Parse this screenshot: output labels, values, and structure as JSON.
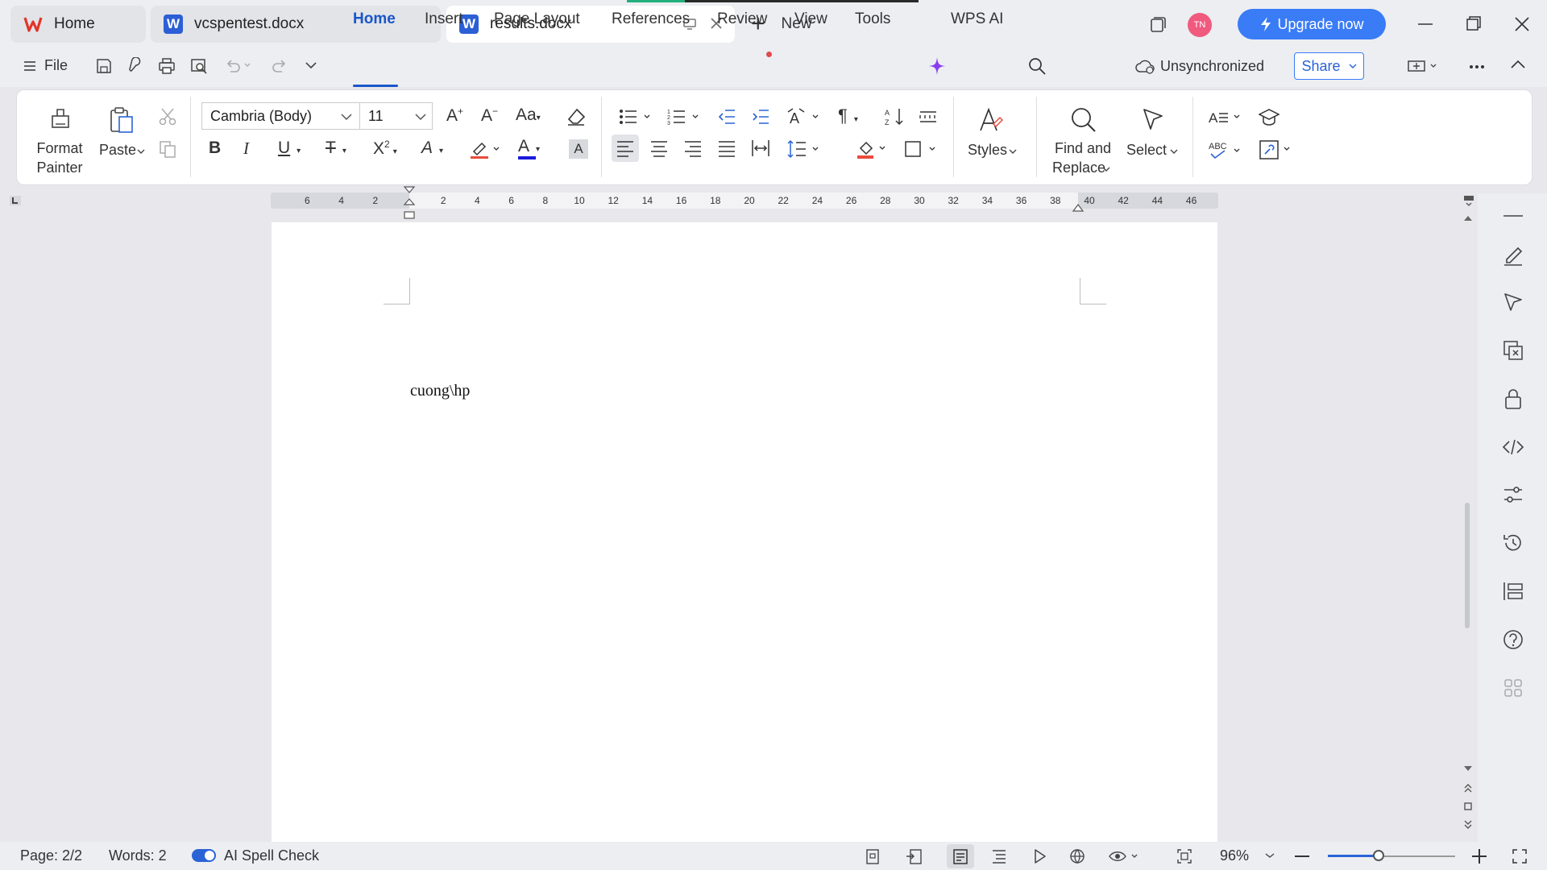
{
  "tabs": [
    {
      "label": "Home",
      "icon": "wps-logo-icon"
    },
    {
      "label": "vcspentest.docx",
      "icon": "word-doc-icon"
    },
    {
      "label": "results.docx",
      "icon": "word-doc-icon",
      "active": true
    }
  ],
  "new_tab_label": "New",
  "avatar_initials": "TN",
  "upgrade_label": "Upgrade now",
  "menu": {
    "file": "File",
    "items": [
      "Home",
      "Insert",
      "Page Layout",
      "References",
      "Review",
      "View",
      "Tools",
      "WPS AI"
    ],
    "sync_status": "Unsynchronized",
    "share": "Share"
  },
  "ribbon": {
    "format_painter_1": "Format",
    "format_painter_2": "Painter",
    "paste": "Paste",
    "font_name": "Cambria (Body)",
    "font_size": "11",
    "styles": "Styles",
    "find_1": "Find and",
    "find_2": "Replace",
    "select": "Select",
    "font_color": "#1a1adb",
    "highlight_color": "#e84c3d"
  },
  "ruler_ticks": [
    "6",
    "4",
    "2",
    "2",
    "4",
    "6",
    "8",
    "10",
    "12",
    "14",
    "16",
    "18",
    "20",
    "22",
    "24",
    "26",
    "28",
    "30",
    "32",
    "34",
    "36",
    "38",
    "40",
    "42",
    "44",
    "46"
  ],
  "document": {
    "text": "cuong\\hp"
  },
  "status": {
    "page": "Page: 2/2",
    "words": "Words: 2",
    "spell_check": "AI Spell Check",
    "zoom": "96%",
    "zoom_fraction": 0.4
  },
  "colors": {
    "accent": "#2a63d6",
    "upgrade": "#3a7bf6",
    "avatar": "#f05a7e"
  }
}
